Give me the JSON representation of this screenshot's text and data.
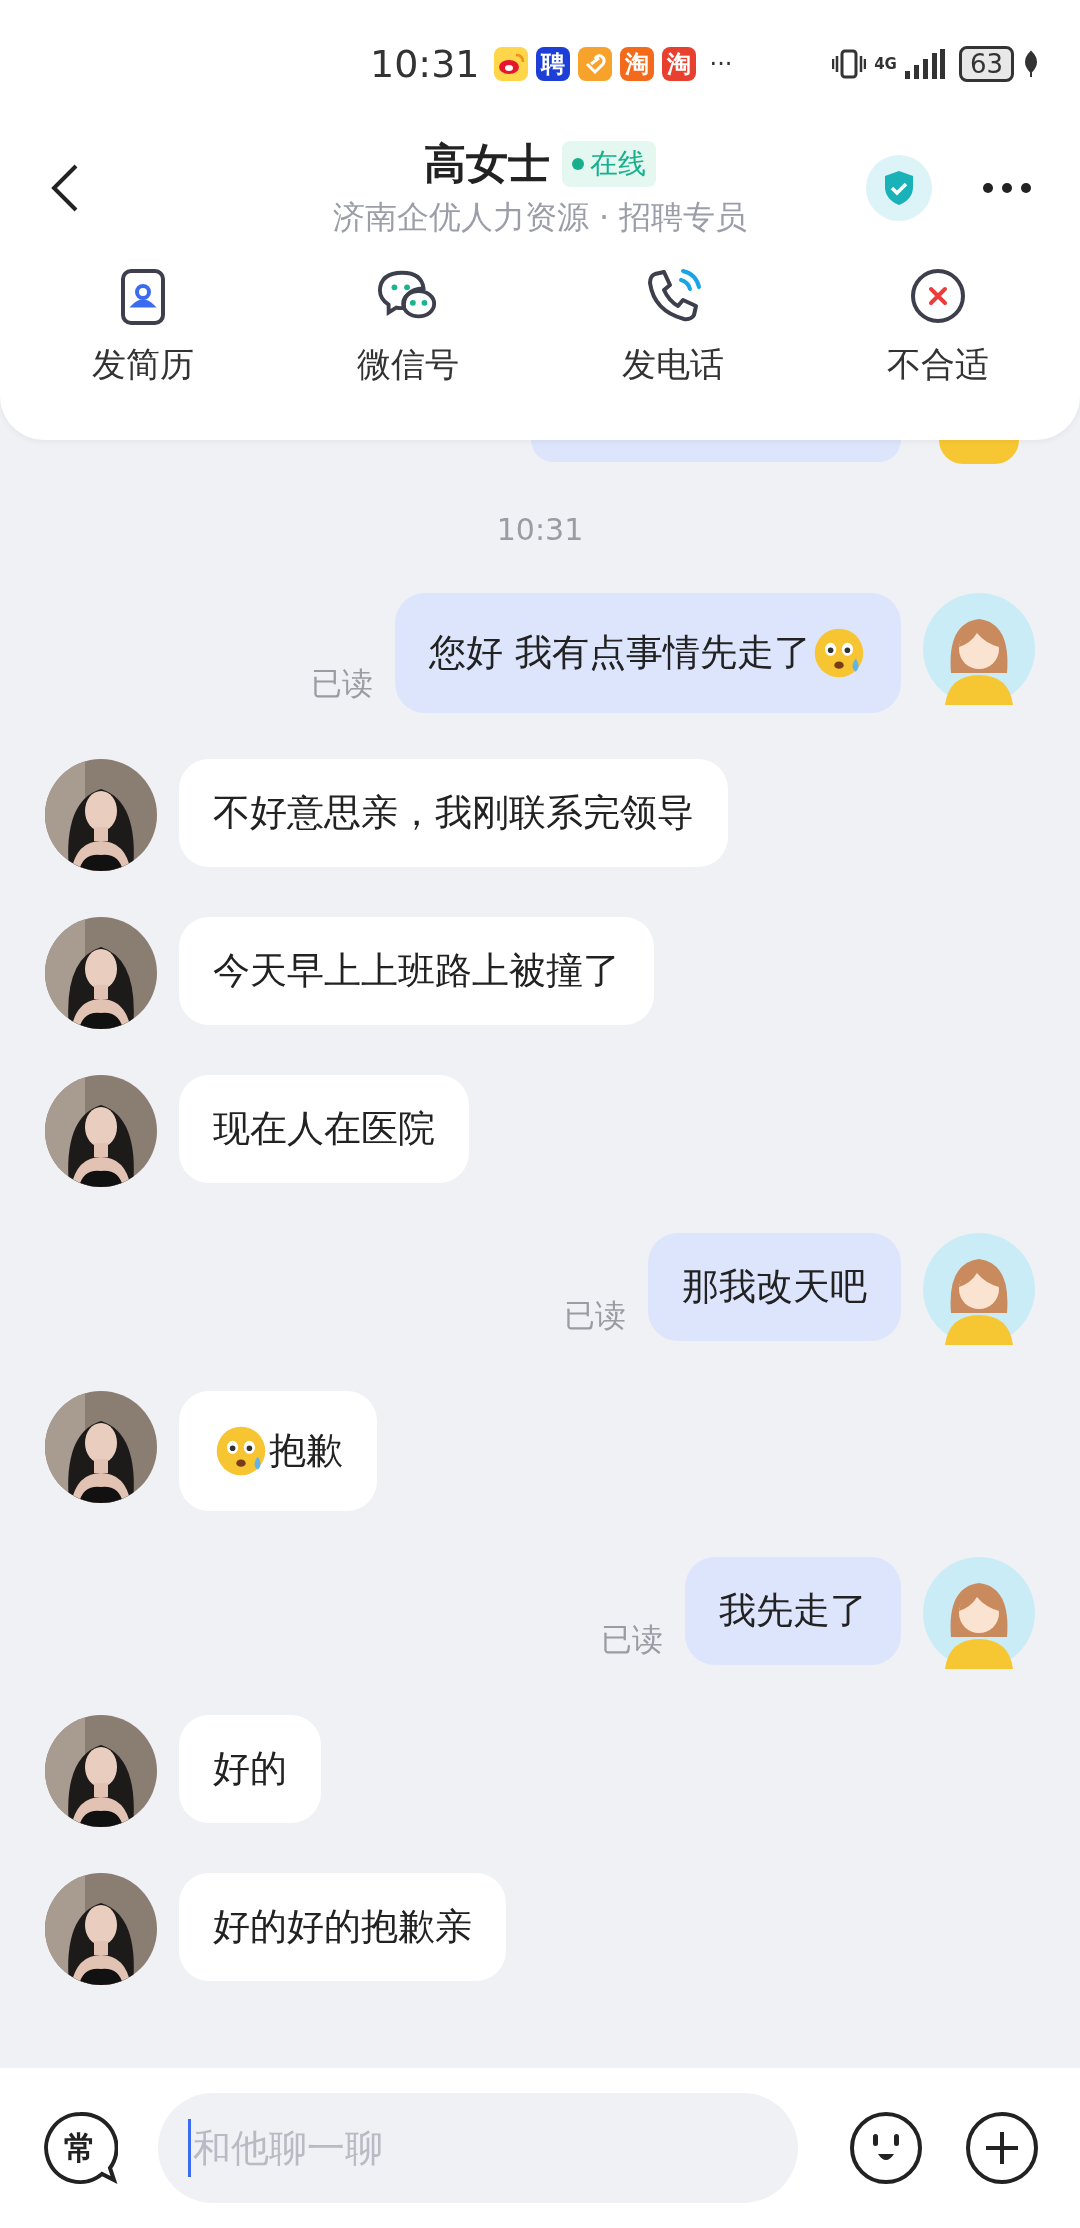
{
  "status_bar": {
    "time": "10:31",
    "notifications": [
      {
        "kind": "weibo"
      },
      {
        "kind": "text",
        "label": "聘",
        "color": "#1d3fd8"
      },
      {
        "kind": "heart",
        "color": "#f7a22b"
      },
      {
        "kind": "text",
        "label": "淘",
        "color": "#f46a1b"
      },
      {
        "kind": "text",
        "label": "淘",
        "color": "#e8402f"
      }
    ],
    "more": "···",
    "network": "4G",
    "battery": "63"
  },
  "header": {
    "title": "高女士",
    "status": "在线",
    "subtitle": "济南企优人力资源 · 招聘专员"
  },
  "actions": [
    {
      "kind": "resume",
      "label": "发简历"
    },
    {
      "kind": "wechat",
      "label": "微信号"
    },
    {
      "kind": "phone",
      "label": "发电话"
    },
    {
      "kind": "reject",
      "label": "不合适"
    }
  ],
  "messages": [
    {
      "kind": "peek"
    },
    {
      "kind": "time",
      "text": "10:31"
    },
    {
      "kind": "sent",
      "parts": [
        {
          "kind": "text",
          "text": "您好 我有点事情先走了"
        },
        {
          "kind": "emoji"
        }
      ],
      "receipt": "已读"
    },
    {
      "kind": "received",
      "parts": [
        {
          "kind": "text",
          "text": "不好意思亲，我刚联系完领导"
        }
      ]
    },
    {
      "kind": "received",
      "parts": [
        {
          "kind": "text",
          "text": "今天早上上班路上被撞了"
        }
      ]
    },
    {
      "kind": "received",
      "parts": [
        {
          "kind": "text",
          "text": "现在人在医院"
        }
      ]
    },
    {
      "kind": "sent",
      "parts": [
        {
          "kind": "text",
          "text": "那我改天吧"
        }
      ],
      "receipt": "已读"
    },
    {
      "kind": "received",
      "parts": [
        {
          "kind": "emoji"
        },
        {
          "kind": "text",
          "text": "抱歉"
        }
      ]
    },
    {
      "kind": "sent",
      "parts": [
        {
          "kind": "text",
          "text": "我先走了"
        }
      ],
      "receipt": "已读"
    },
    {
      "kind": "received",
      "parts": [
        {
          "kind": "text",
          "text": "好的"
        }
      ]
    },
    {
      "kind": "received",
      "parts": [
        {
          "kind": "text",
          "text": "好的好的抱歉亲"
        }
      ]
    }
  ],
  "composer": {
    "phrases": "常",
    "placeholder": "和他聊一聊"
  }
}
